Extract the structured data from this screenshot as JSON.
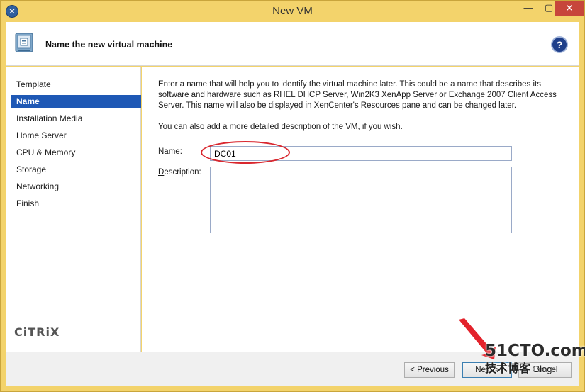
{
  "window": {
    "title": "New VM",
    "close_glyph": "✕",
    "min_glyph": "—",
    "max_glyph": "▢"
  },
  "header": {
    "title": "Name the new virtual machine",
    "help_glyph": "?"
  },
  "sidebar": {
    "items": [
      {
        "label": "Template"
      },
      {
        "label": "Name",
        "active": true
      },
      {
        "label": "Installation Media"
      },
      {
        "label": "Home Server"
      },
      {
        "label": "CPU & Memory"
      },
      {
        "label": "Storage"
      },
      {
        "label": "Networking"
      },
      {
        "label": "Finish"
      }
    ],
    "logo_text": "CiTRiX"
  },
  "content": {
    "description": "Enter a name that will help you to identify the virtual machine later. This could be a name that describes its software and hardware such as RHEL DHCP Server, Win2K3 XenApp Server or Exchange 2007 Client Access Server. This name will also be displayed in XenCenter's Resources pane and can be changed later.",
    "description2": "You can also add a more detailed description of the VM, if you wish.",
    "name_label_pre": "Na",
    "name_label_mnemonic": "m",
    "name_label_post": "e:",
    "name_value": "DC01",
    "description_label_mnemonic": "D",
    "description_label_post": "escription:",
    "description_value": ""
  },
  "footer": {
    "previous_label": "< Previous",
    "next_label": "Next >",
    "cancel_label": "Cancel"
  },
  "watermark": {
    "line1": "51CTO.com",
    "line2": "技术博客",
    "line2_suffix": "Blog"
  },
  "colors": {
    "title_bar": "#f3d36b",
    "selection": "#1e58b5",
    "annotation": "#d9272e",
    "close_button": "#c7463b"
  }
}
